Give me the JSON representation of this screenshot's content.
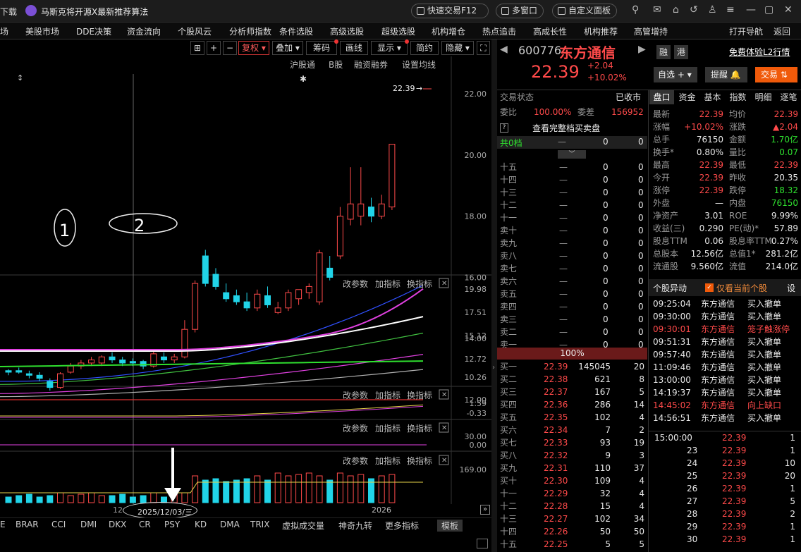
{
  "titlebar": {
    "left_label": "下载",
    "tab_title": "马斯克将开源X最新推荐算法",
    "btn_quick": "快速交易F12",
    "btn_multi": "多窗口",
    "btn_custom": "自定义面板"
  },
  "menu": [
    "场",
    "美股市场",
    "DDE决策",
    "资金流向",
    "个股风云",
    "分析师指数",
    "条件选股",
    "高级选股",
    "超级选股",
    "机构增仓",
    "热点追击",
    "高成长性",
    "机构推荐",
    "高管增持",
    "打开导航",
    "返回"
  ],
  "chart_toolbar": {
    "fuquan": "复权",
    "diejia": "叠加",
    "chouma": "筹码",
    "huaxian": "画线",
    "xianshi": "显示",
    "jianyue": "简约",
    "yincang": "隐藏"
  },
  "kline": {
    "links": [
      "沪股通",
      "B股",
      "融资融券",
      "设置均线"
    ],
    "price_label": "22.39",
    "yticks": [
      "22.00",
      "20.00",
      "18.00",
      "16.00",
      "14.00",
      "12.00"
    ],
    "annot_1": "1",
    "annot_2": "2",
    "candles": [
      {
        "o": 12.9,
        "h": 13.0,
        "l": 12.8,
        "c": 12.95,
        "up": false
      },
      {
        "o": 12.95,
        "h": 13.05,
        "l": 12.85,
        "c": 12.9,
        "up": false
      },
      {
        "o": 12.85,
        "h": 12.95,
        "l": 12.7,
        "c": 12.8,
        "up": false
      },
      {
        "o": 12.8,
        "h": 12.9,
        "l": 12.6,
        "c": 12.7,
        "up": false
      },
      {
        "o": 12.6,
        "h": 12.7,
        "l": 12.3,
        "c": 12.4,
        "up": false
      },
      {
        "o": 12.4,
        "h": 12.9,
        "l": 12.35,
        "c": 12.85,
        "up": true
      },
      {
        "o": 12.9,
        "h": 13.2,
        "l": 12.85,
        "c": 13.1,
        "up": true
      },
      {
        "o": 13.1,
        "h": 13.3,
        "l": 13.0,
        "c": 13.2,
        "up": true
      },
      {
        "o": 13.2,
        "h": 13.4,
        "l": 13.1,
        "c": 13.3,
        "up": true
      },
      {
        "o": 13.2,
        "h": 13.45,
        "l": 13.1,
        "c": 13.4,
        "up": true
      },
      {
        "o": 13.4,
        "h": 13.55,
        "l": 13.2,
        "c": 13.3,
        "up": false
      },
      {
        "o": 13.3,
        "h": 13.4,
        "l": 13.1,
        "c": 13.2,
        "up": false
      },
      {
        "o": 13.2,
        "h": 13.35,
        "l": 13.1,
        "c": 13.25,
        "up": false
      },
      {
        "o": 13.25,
        "h": 13.3,
        "l": 13.0,
        "c": 13.1,
        "up": false
      },
      {
        "o": 13.1,
        "h": 13.6,
        "l": 13.05,
        "c": 13.5,
        "up": true
      },
      {
        "o": 13.4,
        "h": 13.55,
        "l": 13.2,
        "c": 13.3,
        "up": false
      },
      {
        "o": 13.3,
        "h": 13.5,
        "l": 13.2,
        "c": 13.4,
        "up": true
      },
      {
        "o": 13.4,
        "h": 14.6,
        "l": 13.35,
        "c": 14.3,
        "up": true
      },
      {
        "o": 14.3,
        "h": 15.9,
        "l": 14.2,
        "c": 15.8,
        "up": true
      },
      {
        "o": 16.7,
        "h": 16.9,
        "l": 15.7,
        "c": 15.8,
        "up": false
      },
      {
        "o": 16.1,
        "h": 16.3,
        "l": 15.6,
        "c": 15.7,
        "up": false
      },
      {
        "o": 15.5,
        "h": 15.8,
        "l": 15.2,
        "c": 15.3,
        "up": false
      },
      {
        "o": 15.4,
        "h": 15.6,
        "l": 15.1,
        "c": 15.2,
        "up": false
      },
      {
        "o": 15.2,
        "h": 15.5,
        "l": 14.9,
        "c": 15.0,
        "up": false
      },
      {
        "o": 15.0,
        "h": 15.6,
        "l": 14.9,
        "c": 15.45,
        "up": true
      },
      {
        "o": 15.4,
        "h": 15.7,
        "l": 15.0,
        "c": 15.1,
        "up": false
      },
      {
        "o": 14.85,
        "h": 15.2,
        "l": 14.8,
        "c": 15.0,
        "up": true
      },
      {
        "o": 15.0,
        "h": 15.6,
        "l": 14.9,
        "c": 15.5,
        "up": true
      },
      {
        "o": 15.3,
        "h": 15.6,
        "l": 15.1,
        "c": 15.6,
        "up": true
      },
      {
        "o": 15.5,
        "h": 15.8,
        "l": 15.3,
        "c": 15.7,
        "up": true
      },
      {
        "o": 15.2,
        "h": 16.9,
        "l": 15.1,
        "c": 16.8,
        "up": true
      },
      {
        "o": 16.3,
        "h": 16.7,
        "l": 15.9,
        "c": 16.0,
        "up": false
      },
      {
        "o": 16.7,
        "h": 18.3,
        "l": 16.6,
        "c": 18.0,
        "up": true
      },
      {
        "o": 17.9,
        "h": 19.6,
        "l": 17.7,
        "c": 18.4,
        "up": true
      },
      {
        "o": 18.0,
        "h": 19.6,
        "l": 17.7,
        "c": 18.4,
        "up": true
      },
      {
        "o": 18.3,
        "h": 18.6,
        "l": 17.8,
        "c": 18.0,
        "up": false
      },
      {
        "o": 18.0,
        "h": 18.7,
        "l": 17.9,
        "c": 18.4,
        "up": true
      },
      {
        "o": 18.3,
        "h": 20.35,
        "l": 18.2,
        "c": 20.35,
        "up": true
      }
    ]
  },
  "panels": {
    "gaicanshu": "改参数",
    "jiazhibiao": "加指标",
    "huanzhibiao": "换指标"
  },
  "ind1_ticks": [
    "19.98",
    "17.51",
    "15.12",
    "12.72",
    "10.26"
  ],
  "ind2_ticks": [
    "1.59",
    "-0.33"
  ],
  "ind3_ticks": [
    "30.00",
    "0.00"
  ],
  "ind4_ticks": [
    "169.00"
  ],
  "xaxis": {
    "date_label": "2025/12/03/三",
    "year": "2026",
    "left_num": "12"
  },
  "bottom_tabs": [
    "E",
    "BRAR",
    "CCI",
    "DMI",
    "DKX",
    "CR",
    "PSY",
    "KD",
    "DMA",
    "TRIX",
    "虚拟成交量",
    "神奇九转",
    "更多指标",
    "模板"
  ],
  "stock": {
    "code": "600776",
    "name": "东方通信",
    "price": "22.39",
    "change": "+2.04",
    "pct": "+10.02%",
    "rong": "融",
    "gang": "港",
    "l2": "免费体验L2行情",
    "zixuan": "自选",
    "tixing": "提醒",
    "jiaoyi": "交易"
  },
  "status": {
    "label": "交易状态",
    "value": "已收市",
    "weibi_l": "委比",
    "weibi": "100.00%",
    "weicha_l": "委差",
    "weicha": "156952",
    "full_book": "查看完整档买卖盘",
    "total_l": "共0档",
    "zero": "0",
    "pct_bar": "100%"
  },
  "sells": [
    [
      "十五",
      "—",
      "0",
      "0"
    ],
    [
      "十四",
      "—",
      "0",
      "0"
    ],
    [
      "十三",
      "—",
      "0",
      "0"
    ],
    [
      "十二",
      "—",
      "0",
      "0"
    ],
    [
      "十一",
      "—",
      "0",
      "0"
    ],
    [
      "卖十",
      "—",
      "0",
      "0"
    ],
    [
      "卖九",
      "—",
      "0",
      "0"
    ],
    [
      "卖八",
      "—",
      "0",
      "0"
    ],
    [
      "卖七",
      "—",
      "0",
      "0"
    ],
    [
      "卖六",
      "—",
      "0",
      "0"
    ],
    [
      "卖五",
      "—",
      "0",
      "0"
    ],
    [
      "卖四",
      "—",
      "0",
      "0"
    ],
    [
      "卖三",
      "—",
      "0",
      "0"
    ],
    [
      "卖二",
      "—",
      "0",
      "0"
    ],
    [
      "卖一",
      "—",
      "0",
      "0"
    ]
  ],
  "buys": [
    [
      "买一",
      "22.39",
      "145045",
      "20"
    ],
    [
      "买二",
      "22.38",
      "621",
      "8"
    ],
    [
      "买三",
      "22.37",
      "167",
      "5"
    ],
    [
      "买四",
      "22.36",
      "286",
      "14"
    ],
    [
      "买五",
      "22.35",
      "102",
      "4"
    ],
    [
      "买六",
      "22.34",
      "7",
      "2"
    ],
    [
      "买七",
      "22.33",
      "93",
      "19"
    ],
    [
      "买八",
      "22.32",
      "9",
      "3"
    ],
    [
      "买九",
      "22.31",
      "110",
      "37"
    ],
    [
      "买十",
      "22.30",
      "109",
      "4"
    ],
    [
      "十一",
      "22.29",
      "32",
      "4"
    ],
    [
      "十二",
      "22.28",
      "15",
      "4"
    ],
    [
      "十三",
      "22.27",
      "102",
      "34"
    ],
    [
      "十四",
      "22.26",
      "50",
      "50"
    ],
    [
      "十五",
      "22.25",
      "5",
      "5"
    ]
  ],
  "rtabs": [
    "盘口",
    "资金",
    "基本",
    "指数",
    "明细",
    "逐笔"
  ],
  "stats": [
    [
      "最新",
      "22.39",
      "均价",
      "22.39"
    ],
    [
      "涨幅",
      "+10.02%",
      "涨跌",
      "▲2.04"
    ],
    [
      "总手",
      "76150",
      "金额",
      "1.70亿"
    ],
    [
      "换手*",
      "0.80%",
      "量比",
      "0.07"
    ],
    [
      "最高",
      "22.39",
      "最低",
      "22.39"
    ],
    [
      "今开",
      "22.39",
      "昨收",
      "20.35"
    ],
    [
      "涨停",
      "22.39",
      "跌停",
      "18.32"
    ],
    [
      "外盘",
      "—",
      "内盘",
      "76150"
    ],
    [
      "净资产",
      "3.01",
      "ROE",
      "9.99%"
    ],
    [
      "收益(三)",
      "0.290",
      "PE(动)*",
      "57.89"
    ],
    [
      "股息TTM",
      "0.06",
      "股息率TTM",
      "0.27%"
    ],
    [
      "总股本",
      "12.56亿",
      "总值1*",
      "281.2亿"
    ],
    [
      "流通股",
      "9.560亿",
      "流值",
      "214.0亿"
    ]
  ],
  "events_head": {
    "title": "个股异动",
    "check": "仅看当前个股",
    "btn": "设"
  },
  "events": [
    [
      "09:25:04",
      "东方通信",
      "买入撤单"
    ],
    [
      "09:30:00",
      "东方通信",
      "买入撤单"
    ],
    [
      "09:30:01",
      "东方通信",
      "笼子触涨停"
    ],
    [
      "09:51:31",
      "东方通信",
      "买入撤单"
    ],
    [
      "09:57:40",
      "东方通信",
      "买入撤单"
    ],
    [
      "11:09:46",
      "东方通信",
      "买入撤单"
    ],
    [
      "13:00:00",
      "东方通信",
      "买入撤单"
    ],
    [
      "14:19:37",
      "东方通信",
      "买入撤单"
    ],
    [
      "14:45:02",
      "东方通信",
      "向上缺口"
    ],
    [
      "14:56:51",
      "东方通信",
      "买入撤单"
    ]
  ],
  "ticks": [
    [
      "15:00:00",
      "22.39",
      "1"
    ],
    [
      "23",
      "22.39",
      "1"
    ],
    [
      "24",
      "22.39",
      "10"
    ],
    [
      "25",
      "22.39",
      "20"
    ],
    [
      "26",
      "22.39",
      "1"
    ],
    [
      "27",
      "22.39",
      "5"
    ],
    [
      "28",
      "22.39",
      "2"
    ],
    [
      "29",
      "22.39",
      "1"
    ],
    [
      "30",
      "22.39",
      "1"
    ]
  ]
}
